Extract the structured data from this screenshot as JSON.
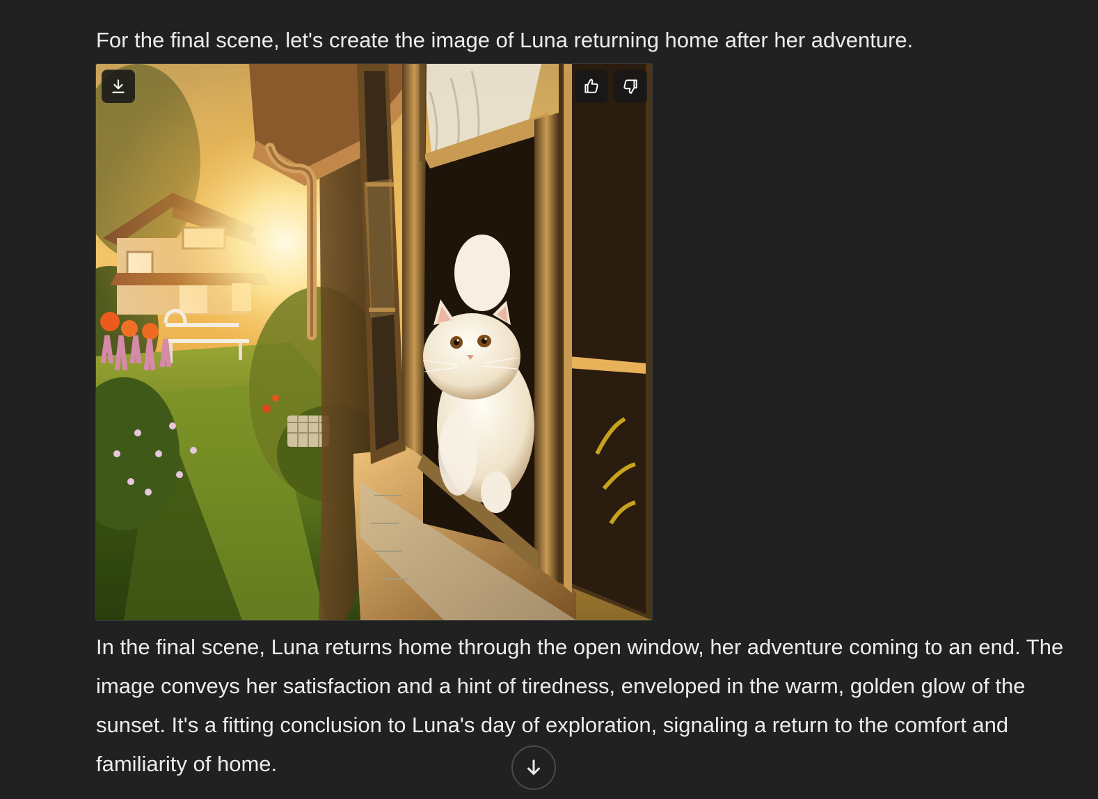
{
  "message": {
    "intro": "For the final scene, let's create the image of Luna returning home after her adventure.",
    "image": {
      "actions": {
        "download_icon": "download-icon",
        "thumbs_up_icon": "thumbs-up-icon",
        "thumbs_down_icon": "thumbs-down-icon"
      }
    },
    "response": "In the final scene, Luna returns home through the open window, her adventure coming to an end. The image conveys her satisfaction and a hint of tiredness, enveloped in the warm, golden glow of the sunset. It's a fitting conclusion to Luna's day of exploration, signaling a return to the comfort and familiarity of home."
  },
  "scroll": {
    "icon": "arrow-down-icon"
  },
  "colors": {
    "background": "#212121",
    "text": "#ececec",
    "overlay_button": "#181818"
  }
}
